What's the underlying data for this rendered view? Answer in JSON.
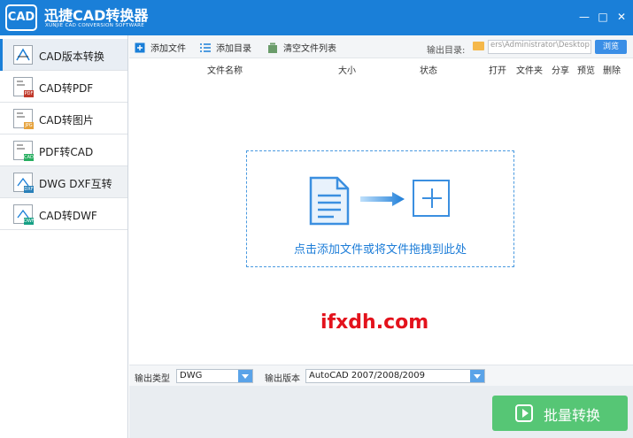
{
  "app": {
    "logo_text": "CAD",
    "title": "迅捷CAD转换器",
    "subtitle": "XUNJIE CAD CONVERSION SOFTWARE"
  },
  "window_controls": {
    "minimize": "—",
    "maximize": "□",
    "close": "✕"
  },
  "sidebar": {
    "items": [
      {
        "label": "CAD版本转换",
        "icon": "cad-version-icon",
        "active": true
      },
      {
        "label": "CAD转PDF",
        "icon": "cad-to-pdf-icon",
        "active": false
      },
      {
        "label": "CAD转图片",
        "icon": "cad-to-image-icon",
        "active": false
      },
      {
        "label": "PDF转CAD",
        "icon": "pdf-to-cad-icon",
        "active": false
      },
      {
        "label": "DWG DXF互转",
        "icon": "dwg-dxf-icon",
        "active": false
      },
      {
        "label": "CAD转DWF",
        "icon": "cad-to-dwf-icon",
        "active": false
      }
    ]
  },
  "toolbar": {
    "add_file": "添加文件",
    "add_folder": "添加目录",
    "clear_list": "清空文件列表",
    "output_dir_label": "输出目录:",
    "output_dir_value": "ers\\Administrator\\Desktop",
    "browse": "浏览"
  },
  "table": {
    "columns": [
      "文件名称",
      "大小",
      "状态",
      "打开",
      "文件夹",
      "分享",
      "预览",
      "删除"
    ]
  },
  "drop_zone": {
    "text": "点击添加文件或将文件拖拽到此处"
  },
  "watermark": "ifxdh.com",
  "options": {
    "output_type_label": "输出类型",
    "output_type_value": "DWG",
    "output_version_label": "输出版本",
    "output_version_value": "AutoCAD 2007/2008/2009"
  },
  "convert_button": {
    "label": "批量转换"
  },
  "colors": {
    "titlebar": "#1a7fd8",
    "accent": "#1d7dd8",
    "convert": "#56c675",
    "watermark": "#e3121c"
  }
}
